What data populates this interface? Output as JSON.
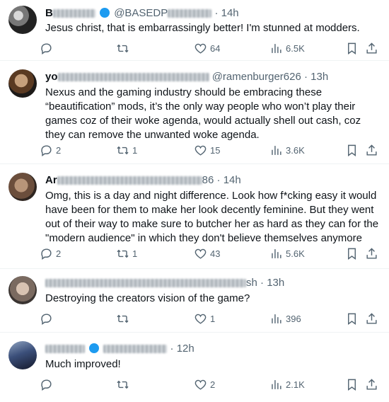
{
  "tweets": [
    {
      "name": "B",
      "handle": "@BASEDP",
      "time": "14h",
      "text": "Jesus christ, that is embarrassingly better! I'm stunned at modders.",
      "replies": "",
      "retweets": "",
      "likes": "64",
      "views": "6.5K"
    },
    {
      "name": "yo",
      "handle": "@ramenburger626",
      "time": "13h",
      "text": "Nexus and the gaming industry should be embracing these “beautification” mods, it’s the only way people who won’t play their games coz of their woke agenda, would actually shell out cash, coz they can remove the unwanted woke agenda.",
      "replies": "2",
      "retweets": "1",
      "likes": "15",
      "views": "3.6K"
    },
    {
      "name": "Ar",
      "handle": "86",
      "time": "14h",
      "text": "Omg, this is a day and night difference. Look how f*cking easy it would have been for them to make her look decently feminine. But they went out of their way to make sure to butcher her as hard as they can for the \"modern audience\" in which they don't believe themselves anymore",
      "replies": "2",
      "retweets": "1",
      "likes": "43",
      "views": "5.6K"
    },
    {
      "name": "",
      "handle": "sh",
      "time": "13h",
      "text": "Destroying the creators vision of the game?",
      "replies": "",
      "retweets": "",
      "likes": "1",
      "views": "396"
    },
    {
      "name": "",
      "handle": "",
      "time": "12h",
      "text": "Much improved!",
      "replies": "",
      "retweets": "",
      "likes": "2",
      "views": "2.1K"
    }
  ],
  "icons": {
    "reply": "reply-icon",
    "retweet": "retweet-icon",
    "like": "heart-icon",
    "views": "views-chart-icon",
    "bookmark": "bookmark-icon",
    "share": "share-icon"
  },
  "colors": {
    "text": "#0f1419",
    "secondary": "#536471",
    "verified": "#1d9bf0",
    "divider": "#eff3f4"
  }
}
